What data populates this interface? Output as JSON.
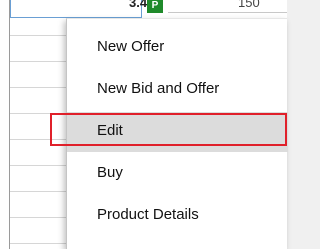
{
  "grid": {
    "price_cell": "3.45",
    "status_badge": "P",
    "quantity_cell": "150",
    "status_color": "#1f8a2a"
  },
  "context_menu": {
    "items": [
      {
        "label": "New Offer"
      },
      {
        "label": "New Bid and Offer"
      },
      {
        "label": "Edit",
        "highlighted": true
      },
      {
        "label": "Buy"
      },
      {
        "label": "Product Details"
      }
    ],
    "highlight_color": "#e0202a"
  }
}
